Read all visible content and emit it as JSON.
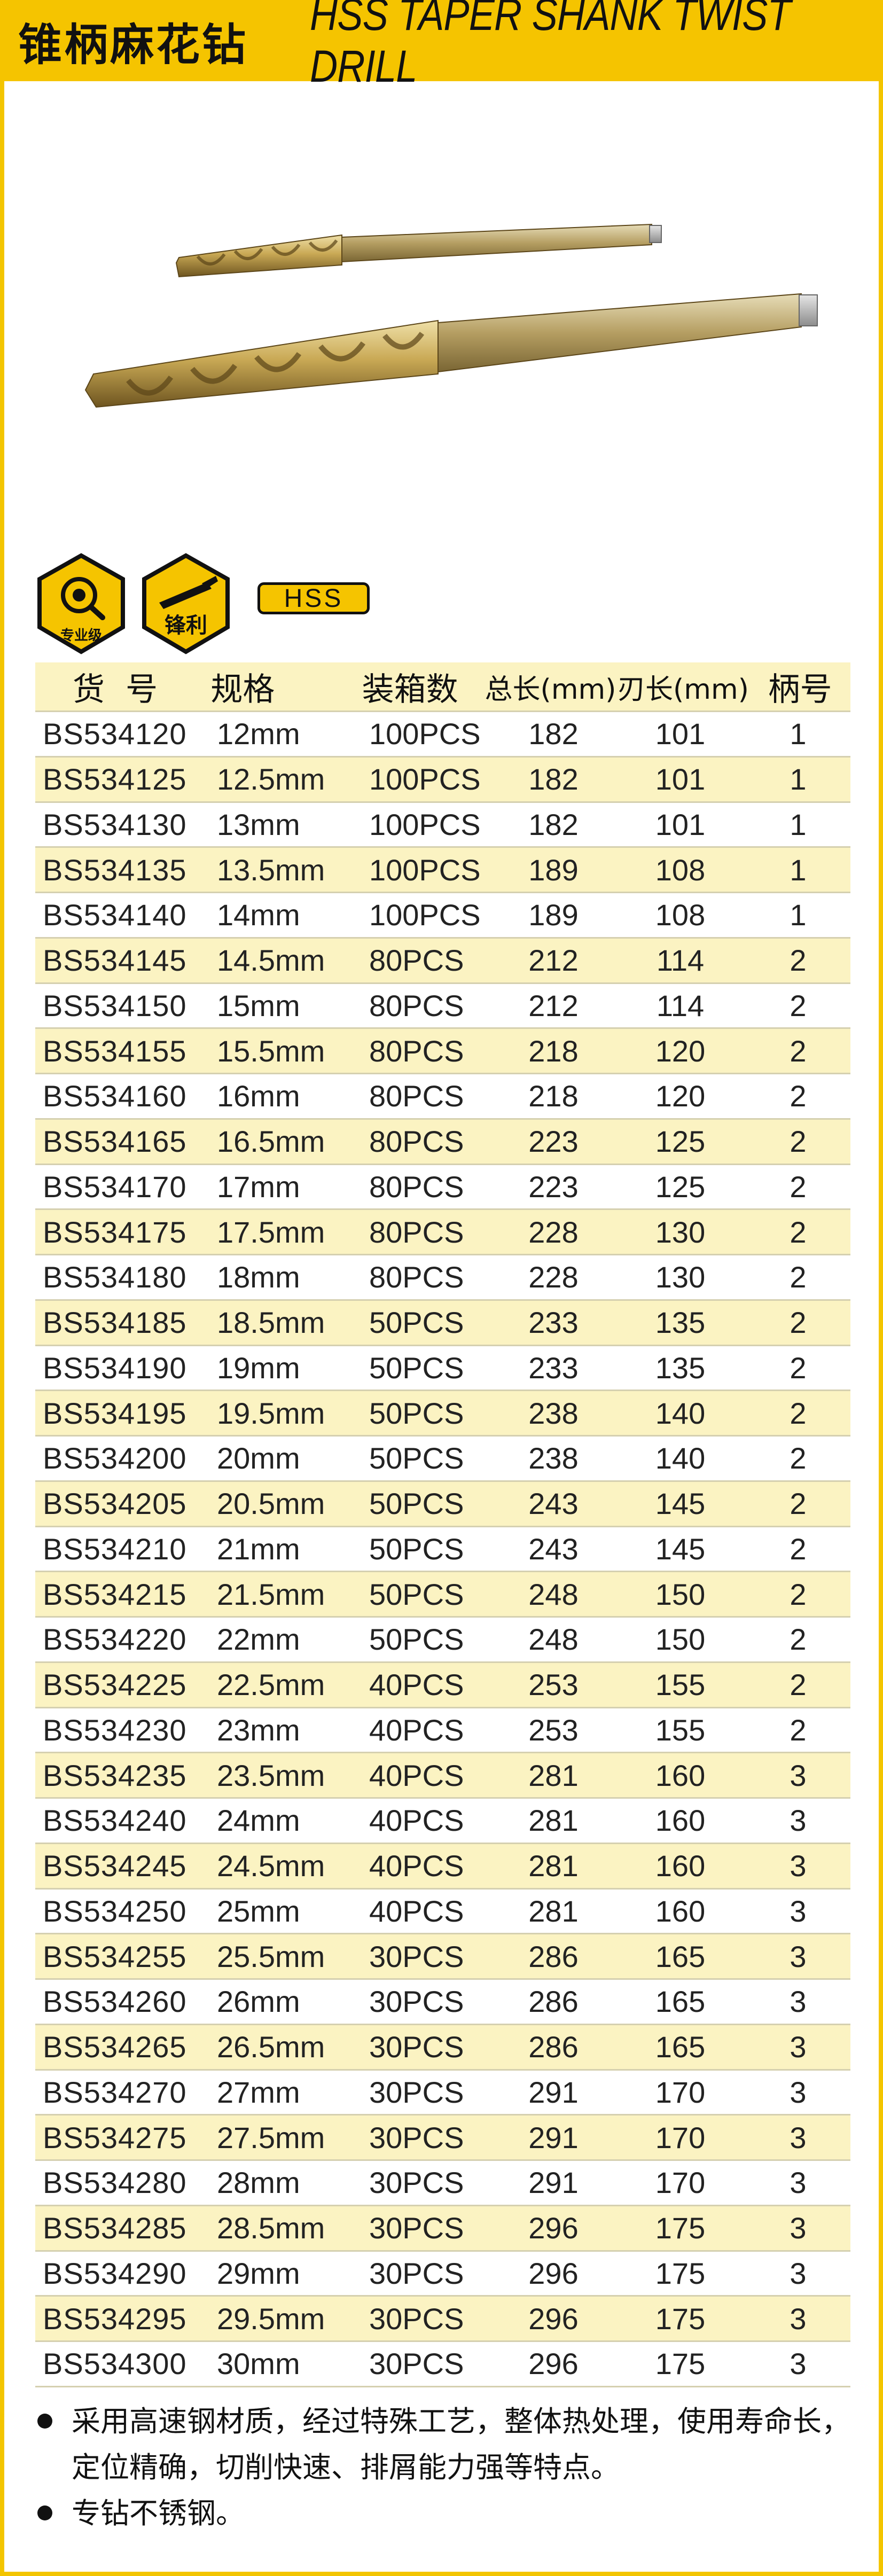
{
  "header": {
    "title_cn": "锥柄麻花钻",
    "title_en": "HSS TAPER SHANK TWIST DRILL"
  },
  "badges": {
    "pro_label": "专业级",
    "sharp_label": "锋利",
    "material": "HSS"
  },
  "table": {
    "headers": [
      "货 号",
      "规格",
      "装箱数",
      "总长(mm)",
      "刃长(mm)",
      "柄号"
    ],
    "rows": [
      [
        "BS534120",
        "12mm",
        "100PCS",
        "182",
        "101",
        "1"
      ],
      [
        "BS534125",
        "12.5mm",
        "100PCS",
        "182",
        "101",
        "1"
      ],
      [
        "BS534130",
        "13mm",
        "100PCS",
        "182",
        "101",
        "1"
      ],
      [
        "BS534135",
        "13.5mm",
        "100PCS",
        "189",
        "108",
        "1"
      ],
      [
        "BS534140",
        "14mm",
        "100PCS",
        "189",
        "108",
        "1"
      ],
      [
        "BS534145",
        "14.5mm",
        "80PCS",
        "212",
        "114",
        "2"
      ],
      [
        "BS534150",
        "15mm",
        "80PCS",
        "212",
        "114",
        "2"
      ],
      [
        "BS534155",
        "15.5mm",
        "80PCS",
        "218",
        "120",
        "2"
      ],
      [
        "BS534160",
        "16mm",
        "80PCS",
        "218",
        "120",
        "2"
      ],
      [
        "BS534165",
        "16.5mm",
        "80PCS",
        "223",
        "125",
        "2"
      ],
      [
        "BS534170",
        "17mm",
        "80PCS",
        "223",
        "125",
        "2"
      ],
      [
        "BS534175",
        "17.5mm",
        "80PCS",
        "228",
        "130",
        "2"
      ],
      [
        "BS534180",
        "18mm",
        "80PCS",
        "228",
        "130",
        "2"
      ],
      [
        "BS534185",
        "18.5mm",
        "50PCS",
        "233",
        "135",
        "2"
      ],
      [
        "BS534190",
        "19mm",
        "50PCS",
        "233",
        "135",
        "2"
      ],
      [
        "BS534195",
        "19.5mm",
        "50PCS",
        "238",
        "140",
        "2"
      ],
      [
        "BS534200",
        "20mm",
        "50PCS",
        "238",
        "140",
        "2"
      ],
      [
        "BS534205",
        "20.5mm",
        "50PCS",
        "243",
        "145",
        "2"
      ],
      [
        "BS534210",
        "21mm",
        "50PCS",
        "243",
        "145",
        "2"
      ],
      [
        "BS534215",
        "21.5mm",
        "50PCS",
        "248",
        "150",
        "2"
      ],
      [
        "BS534220",
        "22mm",
        "50PCS",
        "248",
        "150",
        "2"
      ],
      [
        "BS534225",
        "22.5mm",
        "40PCS",
        "253",
        "155",
        "2"
      ],
      [
        "BS534230",
        "23mm",
        "40PCS",
        "253",
        "155",
        "2"
      ],
      [
        "BS534235",
        "23.5mm",
        "40PCS",
        "281",
        "160",
        "3"
      ],
      [
        "BS534240",
        "24mm",
        "40PCS",
        "281",
        "160",
        "3"
      ],
      [
        "BS534245",
        "24.5mm",
        "40PCS",
        "281",
        "160",
        "3"
      ],
      [
        "BS534250",
        "25mm",
        "40PCS",
        "281",
        "160",
        "3"
      ],
      [
        "BS534255",
        "25.5mm",
        "30PCS",
        "286",
        "165",
        "3"
      ],
      [
        "BS534260",
        "26mm",
        "30PCS",
        "286",
        "165",
        "3"
      ],
      [
        "BS534265",
        "26.5mm",
        "30PCS",
        "286",
        "165",
        "3"
      ],
      [
        "BS534270",
        "27mm",
        "30PCS",
        "291",
        "170",
        "3"
      ],
      [
        "BS534275",
        "27.5mm",
        "30PCS",
        "291",
        "170",
        "3"
      ],
      [
        "BS534280",
        "28mm",
        "30PCS",
        "291",
        "170",
        "3"
      ],
      [
        "BS534285",
        "28.5mm",
        "30PCS",
        "296",
        "175",
        "3"
      ],
      [
        "BS534290",
        "29mm",
        "30PCS",
        "296",
        "175",
        "3"
      ],
      [
        "BS534295",
        "29.5mm",
        "30PCS",
        "296",
        "175",
        "3"
      ],
      [
        "BS534300",
        "30mm",
        "30PCS",
        "296",
        "175",
        "3"
      ]
    ]
  },
  "notes": [
    "采用高速钢材质，经过特殊工艺，整体热处理，使用寿命长，定位精确，切削快速、排屑能力强等特点。",
    "专钻不锈钢。"
  ],
  "colors": {
    "accent": "#f5c400",
    "row_alt": "#fbf3c2",
    "drill_gold": "#c8a850"
  }
}
